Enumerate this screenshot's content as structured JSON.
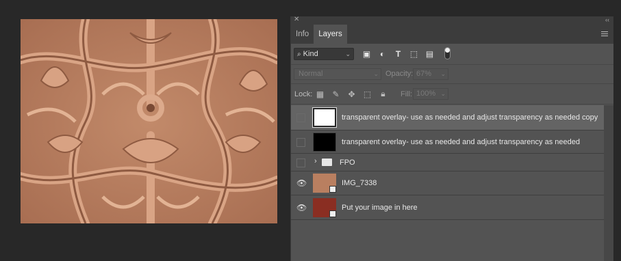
{
  "panel": {
    "tabs": [
      {
        "label": "Info",
        "active": false
      },
      {
        "label": "Layers",
        "active": true
      }
    ],
    "filter": {
      "kind_label": "Kind"
    },
    "blend": {
      "mode": "Normal",
      "opacity_label": "Opacity:",
      "opacity_value": "67%"
    },
    "lock": {
      "label": "Lock:",
      "fill_label": "Fill:",
      "fill_value": "100%"
    },
    "layers": [
      {
        "name": "transparent overlay- use as needed and adjust transparency as needed copy",
        "visible": false,
        "thumb": "white",
        "selected": true
      },
      {
        "name": "transparent overlay- use as needed and adjust transparency as needed",
        "visible": false,
        "thumb": "black",
        "selected": false
      },
      {
        "name": "FPO",
        "visible": false,
        "thumb": "folder",
        "selected": false
      },
      {
        "name": "IMG_7338",
        "visible": true,
        "thumb": "carving",
        "selected": false
      },
      {
        "name": "Put your image in here",
        "visible": true,
        "thumb": "red-pattern",
        "selected": false
      }
    ]
  },
  "colors": {
    "accent": "#535353",
    "selected_row": "#646464",
    "background": "#282828"
  }
}
